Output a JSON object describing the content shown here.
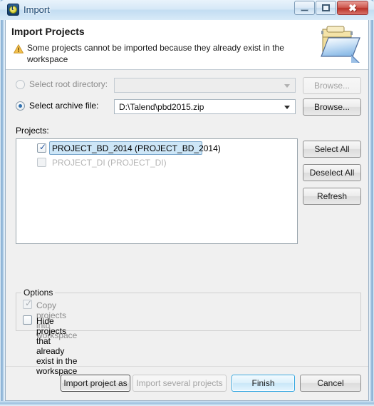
{
  "window": {
    "title": "Import",
    "app_icon": "talend-logo-icon",
    "controls": {
      "minimize": "minimize-icon",
      "maximize": "maximize-icon",
      "close": "close-icon"
    }
  },
  "header": {
    "title": "Import Projects",
    "warning_icon": "warning-triangle-icon",
    "message": "Some projects cannot be imported because they already exist in the workspace",
    "banner_icon": "open-folder-icon"
  },
  "source": {
    "root_directory": {
      "radio_label": "Select root directory:",
      "selected": false,
      "enabled": false,
      "value": "",
      "browse_label": "Browse...",
      "browse_enabled": false
    },
    "archive_file": {
      "radio_label": "Select archive file:",
      "selected": true,
      "enabled": true,
      "value": "D:\\Talend\\pbd2015.zip",
      "browse_label": "Browse...",
      "browse_enabled": true
    }
  },
  "projects": {
    "label": "Projects:",
    "items": [
      {
        "text": "PROJECT_BD_2014 (PROJECT_BD_2014)",
        "checked": true,
        "enabled": true,
        "selected": true
      },
      {
        "text": "PROJECT_DI (PROJECT_DI)",
        "checked": false,
        "enabled": false,
        "selected": false
      }
    ],
    "buttons": {
      "select_all": "Select All",
      "deselect_all": "Deselect All",
      "refresh": "Refresh"
    }
  },
  "options": {
    "legend": "Options",
    "items": [
      {
        "label": "Copy projects into workspace",
        "checked": true,
        "enabled": false
      },
      {
        "label": "Hide projects that already exist in the workspace",
        "checked": false,
        "enabled": true
      }
    ]
  },
  "footer": {
    "import_project_as": "Import project as",
    "import_several_projects": "Import several projects",
    "import_several_enabled": false,
    "finish": "Finish",
    "cancel": "Cancel"
  },
  "colors": {
    "accent": "#2fa5e0",
    "selection": "#cde6f7",
    "warning": "#e8a92e",
    "title_text": "#16436e",
    "close_button": "#b93228"
  }
}
